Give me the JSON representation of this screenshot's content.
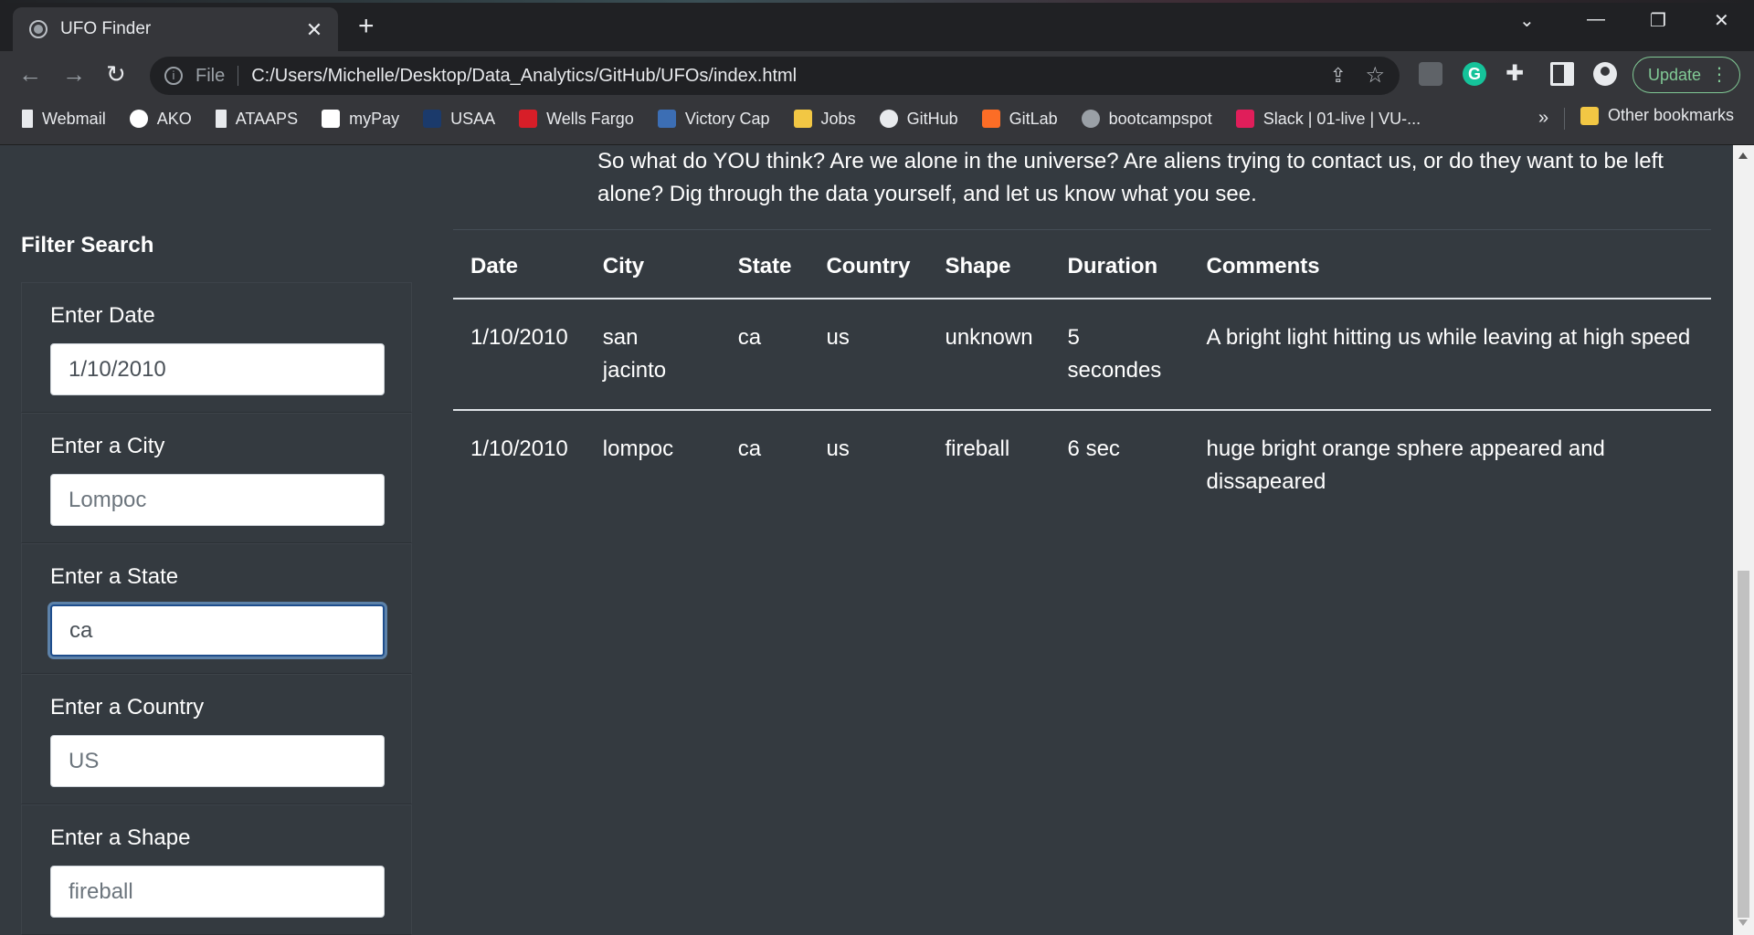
{
  "browser": {
    "tab_title": "UFO Finder",
    "url_scheme": "File",
    "url": "C:/Users/Michelle/Desktop/Data_Analytics/GitHub/UFOs/index.html",
    "update_label": "Update",
    "bookmarks": [
      {
        "label": "Webmail",
        "icon": "document-icon",
        "color": "#e8eaed"
      },
      {
        "label": "AKO",
        "icon": "google-icon",
        "color": "#ffffff"
      },
      {
        "label": "ATAAPS",
        "icon": "document-icon",
        "color": "#e8eaed"
      },
      {
        "label": "myPay",
        "icon": "mypay-icon",
        "color": "#ffffff"
      },
      {
        "label": "USAA",
        "icon": "usaa-icon",
        "color": "#1b3a6b"
      },
      {
        "label": "Wells Fargo",
        "icon": "wellsfargo-icon",
        "color": "#d71e28"
      },
      {
        "label": "Victory Cap",
        "icon": "victorycap-icon",
        "color": "#3c6eb4"
      },
      {
        "label": "Jobs",
        "icon": "folder-icon",
        "color": "#f2c744"
      },
      {
        "label": "GitHub",
        "icon": "github-icon",
        "color": "#e8eaed"
      },
      {
        "label": "GitLab",
        "icon": "gitlab-icon",
        "color": "#fc6d26"
      },
      {
        "label": "bootcampspot",
        "icon": "globe-icon",
        "color": "#9aa0a6"
      },
      {
        "label": "Slack | 01-live | VU-...",
        "icon": "slack-icon",
        "color": "#e01e5a"
      }
    ],
    "other_bookmarks": "Other bookmarks"
  },
  "intro_text": "So what do YOU think? Are we alone in the universe? Are aliens trying to contact us, or do they want to be left alone? Dig through the data yourself, and let us know what you see.",
  "filters": {
    "heading": "Filter Search",
    "items": [
      {
        "label": "Enter Date",
        "value": "1/10/2010",
        "placeholder": "",
        "focused": false
      },
      {
        "label": "Enter a City",
        "value": "",
        "placeholder": "Lompoc",
        "focused": false
      },
      {
        "label": "Enter a State",
        "value": "ca",
        "placeholder": "",
        "focused": true
      },
      {
        "label": "Enter a Country",
        "value": "",
        "placeholder": "US",
        "focused": false
      },
      {
        "label": "Enter a Shape",
        "value": "",
        "placeholder": "fireball",
        "focused": false
      }
    ]
  },
  "table": {
    "headers": [
      "Date",
      "City",
      "State",
      "Country",
      "Shape",
      "Duration",
      "Comments"
    ],
    "rows": [
      [
        "1/10/2010",
        "san jacinto",
        "ca",
        "us",
        "unknown",
        "5 secondes",
        "A bright light hitting us while leaving at high speed"
      ],
      [
        "1/10/2010",
        "lompoc",
        "ca",
        "us",
        "fireball",
        "6 sec",
        "huge bright orange sphere appeared and dissapeared"
      ]
    ]
  }
}
